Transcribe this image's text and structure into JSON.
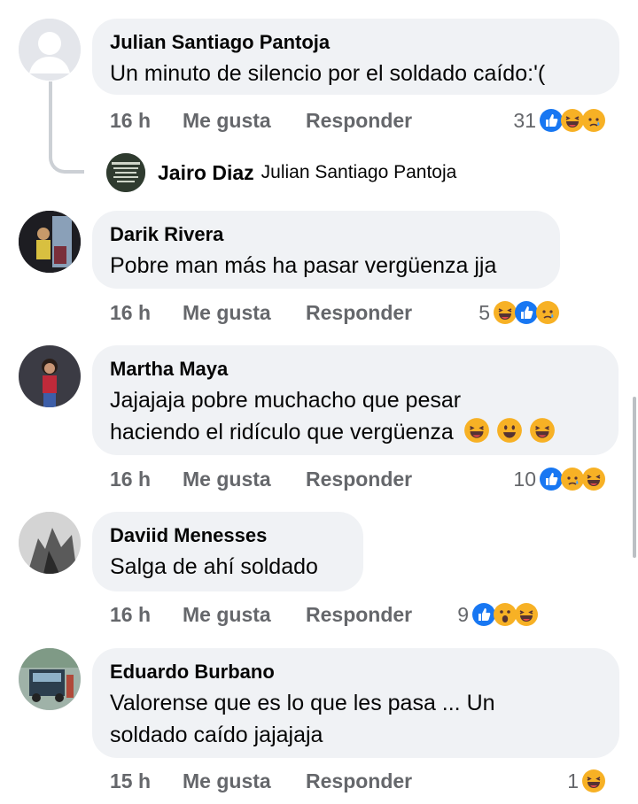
{
  "comments": [
    {
      "author": "Julian Santiago Pantoja",
      "text": "Un minuto de silencio por el soldado caído:'(",
      "time": "16 h",
      "like_label": "Me gusta",
      "reply_label": "Responder",
      "reaction_count": "31",
      "reactions": [
        "like-icon",
        "haha-icon",
        "sad-icon"
      ],
      "reply": {
        "author": "Jairo Diaz",
        "mention": "Julian Santiago Pantoja"
      }
    },
    {
      "author": "Darik Rivera",
      "text": "Pobre man más ha pasar vergüenza jja",
      "time": "16 h",
      "like_label": "Me gusta",
      "reply_label": "Responder",
      "reaction_count": "5",
      "reactions": [
        "haha-icon",
        "like-icon",
        "sad-icon"
      ]
    },
    {
      "author": "Martha Maya",
      "text_line1": "Jajajaja pobre muchacho que pesar",
      "text_line2": "haciendo el ridículo que vergüenza",
      "inline_emojis": [
        "laughing-tears-emoji",
        "smile-emoji",
        "laughing-tears-emoji"
      ],
      "time": "16 h",
      "like_label": "Me gusta",
      "reply_label": "Responder",
      "reaction_count": "10",
      "reactions": [
        "like-icon",
        "sad-icon",
        "haha-icon"
      ]
    },
    {
      "author": "Daviid Menesses",
      "text": "Salga de ahí soldado",
      "time": "16 h",
      "like_label": "Me gusta",
      "reply_label": "Responder",
      "reaction_count": "9",
      "reactions": [
        "like-icon",
        "wow-icon",
        "haha-icon"
      ]
    },
    {
      "author": "Eduardo Burbano",
      "text_line1": "Valorense que es lo que les pasa ... Un",
      "text_line2": "soldado caído jajajaja",
      "time": "15 h",
      "like_label": "Me gusta",
      "reply_label": "Responder",
      "reaction_count": "1",
      "reactions": [
        "haha-icon"
      ]
    }
  ],
  "colors": {
    "bubble": "#f0f2f5",
    "meta_text": "#65676b",
    "like_blue": "#1877f2",
    "emoji_yellow": "#f7b125"
  }
}
